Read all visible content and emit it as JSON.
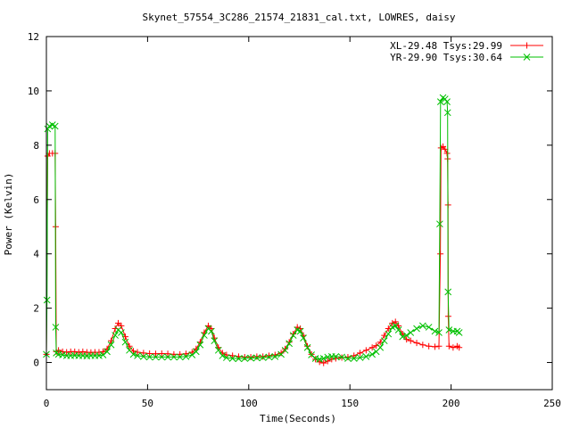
{
  "chart_data": {
    "type": "line",
    "title": "Skynet_57554_3C286_21574_21831_cal.txt, LOWRES, daisy",
    "xlabel": "Time(Seconds)",
    "ylabel": "Power (Kelvin)",
    "xlim": [
      0,
      250
    ],
    "ylim": [
      -1,
      12
    ],
    "xticks": [
      0,
      50,
      100,
      150,
      200,
      250
    ],
    "yticks": [
      0,
      2,
      4,
      6,
      8,
      10,
      12
    ],
    "legend_position": "top-right",
    "grid": false,
    "series": [
      {
        "name": "XL-29.48 Tsys:29.99",
        "color": "#ff0000",
        "marker": "plus",
        "points": [
          [
            0.0,
            0.3
          ],
          [
            0.6,
            7.6
          ],
          [
            1.5,
            7.7
          ],
          [
            3.0,
            7.7
          ],
          [
            4.3,
            7.7
          ],
          [
            4.6,
            5.0
          ],
          [
            4.9,
            0.4
          ],
          [
            6,
            0.45
          ],
          [
            8,
            0.4
          ],
          [
            10,
            0.38
          ],
          [
            12,
            0.4
          ],
          [
            14,
            0.4
          ],
          [
            16,
            0.38
          ],
          [
            18,
            0.4
          ],
          [
            20,
            0.38
          ],
          [
            22,
            0.37
          ],
          [
            24,
            0.38
          ],
          [
            26,
            0.38
          ],
          [
            28,
            0.4
          ],
          [
            30,
            0.5
          ],
          [
            32,
            0.8
          ],
          [
            34,
            1.25
          ],
          [
            35.5,
            1.45
          ],
          [
            37,
            1.35
          ],
          [
            39,
            0.95
          ],
          [
            41,
            0.6
          ],
          [
            43,
            0.42
          ],
          [
            45,
            0.38
          ],
          [
            48,
            0.35
          ],
          [
            51,
            0.33
          ],
          [
            54,
            0.32
          ],
          [
            57,
            0.33
          ],
          [
            60,
            0.32
          ],
          [
            63,
            0.3
          ],
          [
            66,
            0.3
          ],
          [
            69,
            0.32
          ],
          [
            72,
            0.38
          ],
          [
            74,
            0.5
          ],
          [
            76,
            0.75
          ],
          [
            78,
            1.1
          ],
          [
            80,
            1.35
          ],
          [
            81.5,
            1.25
          ],
          [
            83,
            0.9
          ],
          [
            85,
            0.55
          ],
          [
            87,
            0.35
          ],
          [
            89,
            0.28
          ],
          [
            92,
            0.25
          ],
          [
            95,
            0.22
          ],
          [
            98,
            0.2
          ],
          [
            101,
            0.2
          ],
          [
            104,
            0.22
          ],
          [
            107,
            0.22
          ],
          [
            110,
            0.25
          ],
          [
            113,
            0.28
          ],
          [
            116,
            0.35
          ],
          [
            118,
            0.5
          ],
          [
            120,
            0.75
          ],
          [
            122,
            1.05
          ],
          [
            124,
            1.3
          ],
          [
            125.5,
            1.25
          ],
          [
            127,
            1.0
          ],
          [
            129,
            0.6
          ],
          [
            131,
            0.3
          ],
          [
            133,
            0.12
          ],
          [
            135,
            0.02
          ],
          [
            137,
            -0.02
          ],
          [
            139,
            0.05
          ],
          [
            141,
            0.12
          ],
          [
            143,
            0.15
          ],
          [
            146,
            0.18
          ],
          [
            149,
            0.2
          ],
          [
            152,
            0.25
          ],
          [
            155,
            0.35
          ],
          [
            158,
            0.45
          ],
          [
            161,
            0.55
          ],
          [
            163,
            0.62
          ],
          [
            165,
            0.75
          ],
          [
            167,
            1.0
          ],
          [
            169,
            1.25
          ],
          [
            171,
            1.45
          ],
          [
            172.5,
            1.5
          ],
          [
            174,
            1.35
          ],
          [
            176,
            1.05
          ],
          [
            178,
            0.85
          ],
          [
            180,
            0.8
          ],
          [
            183,
            0.72
          ],
          [
            186,
            0.65
          ],
          [
            189,
            0.6
          ],
          [
            192,
            0.58
          ],
          [
            194,
            0.6
          ],
          [
            194.7,
            4.0
          ],
          [
            195,
            7.9
          ],
          [
            196,
            7.95
          ],
          [
            197,
            7.85
          ],
          [
            198,
            7.7
          ],
          [
            198.3,
            7.5
          ],
          [
            198.5,
            5.8
          ],
          [
            198.6,
            1.7
          ],
          [
            199,
            0.6
          ],
          [
            201,
            0.55
          ],
          [
            203,
            0.6
          ],
          [
            204,
            0.55
          ]
        ]
      },
      {
        "name": "YR-29.90 Tsys:30.64",
        "color": "#00c000",
        "marker": "cross",
        "points": [
          [
            0.0,
            0.3
          ],
          [
            0.3,
            2.3
          ],
          [
            0.6,
            8.6
          ],
          [
            1.5,
            8.7
          ],
          [
            3.0,
            8.75
          ],
          [
            4.3,
            8.7
          ],
          [
            4.6,
            1.3
          ],
          [
            4.9,
            0.35
          ],
          [
            6,
            0.3
          ],
          [
            8,
            0.28
          ],
          [
            10,
            0.25
          ],
          [
            12,
            0.25
          ],
          [
            14,
            0.26
          ],
          [
            16,
            0.25
          ],
          [
            18,
            0.25
          ],
          [
            20,
            0.24
          ],
          [
            22,
            0.25
          ],
          [
            24,
            0.25
          ],
          [
            26,
            0.25
          ],
          [
            28,
            0.28
          ],
          [
            30,
            0.4
          ],
          [
            32,
            0.65
          ],
          [
            34,
            1.0
          ],
          [
            35.5,
            1.2
          ],
          [
            37,
            1.1
          ],
          [
            39,
            0.75
          ],
          [
            41,
            0.45
          ],
          [
            43,
            0.3
          ],
          [
            45,
            0.25
          ],
          [
            48,
            0.22
          ],
          [
            51,
            0.2
          ],
          [
            54,
            0.2
          ],
          [
            57,
            0.2
          ],
          [
            60,
            0.2
          ],
          [
            63,
            0.2
          ],
          [
            66,
            0.2
          ],
          [
            69,
            0.22
          ],
          [
            72,
            0.28
          ],
          [
            74,
            0.4
          ],
          [
            76,
            0.65
          ],
          [
            78,
            1.0
          ],
          [
            80,
            1.25
          ],
          [
            81.5,
            1.15
          ],
          [
            83,
            0.8
          ],
          [
            85,
            0.45
          ],
          [
            87,
            0.25
          ],
          [
            89,
            0.18
          ],
          [
            92,
            0.15
          ],
          [
            95,
            0.14
          ],
          [
            98,
            0.15
          ],
          [
            101,
            0.16
          ],
          [
            104,
            0.17
          ],
          [
            107,
            0.18
          ],
          [
            110,
            0.2
          ],
          [
            113,
            0.22
          ],
          [
            116,
            0.3
          ],
          [
            118,
            0.45
          ],
          [
            120,
            0.7
          ],
          [
            122,
            1.0
          ],
          [
            124,
            1.2
          ],
          [
            125.5,
            1.15
          ],
          [
            127,
            0.9
          ],
          [
            129,
            0.55
          ],
          [
            131,
            0.28
          ],
          [
            133,
            0.15
          ],
          [
            135,
            0.12
          ],
          [
            137,
            0.15
          ],
          [
            139,
            0.2
          ],
          [
            141,
            0.22
          ],
          [
            143,
            0.22
          ],
          [
            146,
            0.2
          ],
          [
            149,
            0.15
          ],
          [
            152,
            0.15
          ],
          [
            155,
            0.18
          ],
          [
            158,
            0.22
          ],
          [
            161,
            0.3
          ],
          [
            163,
            0.4
          ],
          [
            165,
            0.55
          ],
          [
            167,
            0.8
          ],
          [
            169,
            1.05
          ],
          [
            171,
            1.3
          ],
          [
            172.5,
            1.35
          ],
          [
            174,
            1.2
          ],
          [
            176,
            0.95
          ],
          [
            178,
            1.0
          ],
          [
            180,
            1.1
          ],
          [
            183,
            1.25
          ],
          [
            186,
            1.35
          ],
          [
            189,
            1.3
          ],
          [
            192,
            1.15
          ],
          [
            194,
            1.1
          ],
          [
            194.4,
            5.1
          ],
          [
            194.8,
            9.6
          ],
          [
            196,
            9.75
          ],
          [
            197,
            9.7
          ],
          [
            198,
            9.6
          ],
          [
            198.3,
            9.2
          ],
          [
            198.5,
            2.6
          ],
          [
            199,
            1.2
          ],
          [
            201,
            1.15
          ],
          [
            203,
            1.15
          ],
          [
            204,
            1.1
          ]
        ]
      }
    ]
  }
}
